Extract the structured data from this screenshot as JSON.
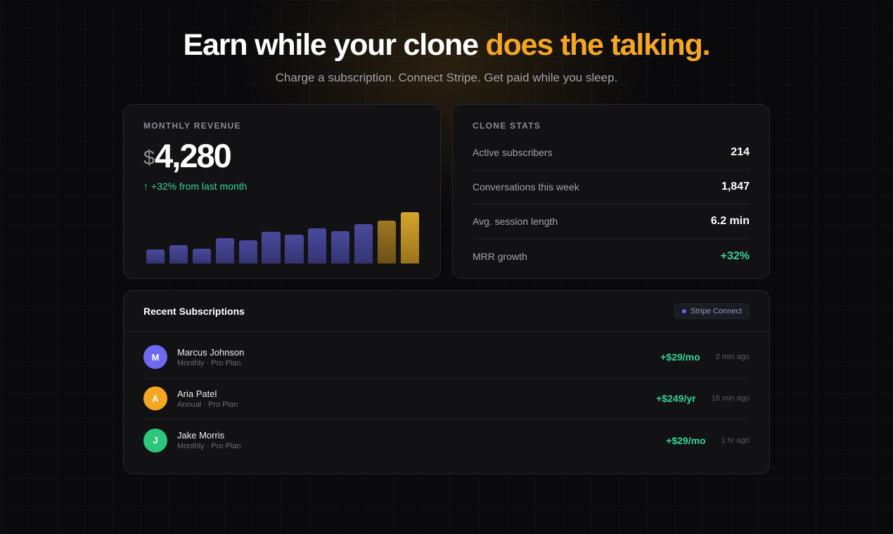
{
  "hero": {
    "title_main": "Earn while your clone ",
    "title_accent": "does the talking.",
    "subtitle": "Charge a subscription. Connect Stripe. Get paid while you sleep."
  },
  "revenue": {
    "label": "MONTHLY REVENUE",
    "currency": "$",
    "amount": "4,280",
    "change": "↑ +32% from last month",
    "bars": [
      26,
      34,
      28,
      48,
      43,
      59,
      54,
      66,
      61,
      74,
      80,
      96
    ],
    "bars_max": 100
  },
  "stats": {
    "label": "CLONE STATS",
    "rows": [
      {
        "name": "Active subscribers",
        "value": "214"
      },
      {
        "name": "Conversations this week",
        "value": "1,847"
      },
      {
        "name": "Avg. session length",
        "value": "6.2 min"
      },
      {
        "name": "MRR growth",
        "value": "+32%"
      }
    ]
  },
  "subs": {
    "title": "Recent Subscriptions",
    "badge": "Stripe Connect",
    "items": [
      {
        "initial": "M",
        "name": "Marcus Johnson",
        "plan": "Monthly · Pro Plan",
        "amount": "+$29/mo",
        "time": "2 min ago",
        "color": "#6d6af0"
      },
      {
        "initial": "A",
        "name": "Aria Patel",
        "plan": "Annual · Pro Plan",
        "amount": "+$249/yr",
        "time": "18 min ago",
        "color": "#f5a623"
      },
      {
        "initial": "J",
        "name": "Jake Morris",
        "plan": "Monthly · Pro Plan",
        "amount": "+$29/mo",
        "time": "1 hr ago",
        "color": "#2cc77a"
      }
    ]
  },
  "colors": {
    "accent": "#f5a623",
    "positive": "#34d399",
    "bar": "#4a4a9c"
  }
}
